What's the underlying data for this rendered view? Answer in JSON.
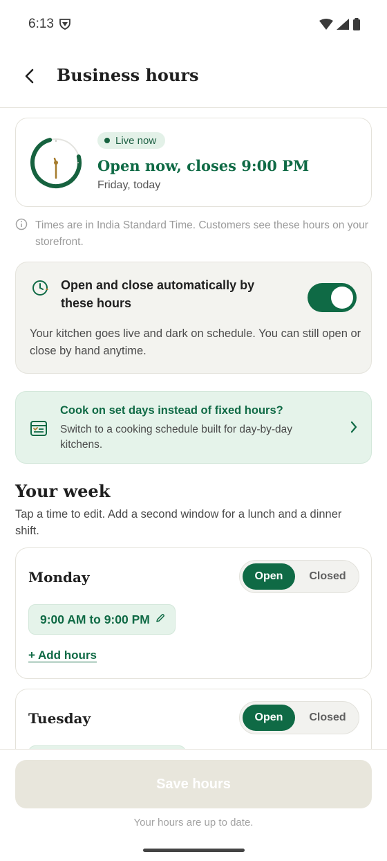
{
  "status_bar": {
    "time": "6:13"
  },
  "header": {
    "title": "Business hours"
  },
  "live_card": {
    "badge": "Live now",
    "status": "Open now, closes 9:00 PM",
    "date": "Friday, today"
  },
  "timezone_note": "Times are in India Standard Time. Customers see these hours on your storefront.",
  "auto_card": {
    "title": "Open and close automatically by these hours",
    "toggle_on": true,
    "description": "Your kitchen goes live and dark on schedule. You can still open or close by hand anytime."
  },
  "promo": {
    "title": "Cook on set days instead of fixed hours?",
    "description": "Switch to a cooking schedule built for day-by-day kitchens."
  },
  "week": {
    "title": "Your week",
    "subtitle": "Tap a time to edit. Add a second window for a lunch and a dinner shift.",
    "open_label": "Open",
    "closed_label": "Closed",
    "add_hours_label": "+ Add hours",
    "days": [
      {
        "name": "Monday",
        "status": "Open",
        "window": "9:00 AM to 9:00 PM"
      },
      {
        "name": "Tuesday",
        "status": "Open"
      }
    ]
  },
  "footer": {
    "save_label": "Save hours",
    "note": "Your hours are up to date."
  },
  "colors": {
    "accent": "#0f6a45",
    "accent_light": "#e5f3ea",
    "clock_ring": "#16623f",
    "clock_hand": "#a67c2d"
  }
}
